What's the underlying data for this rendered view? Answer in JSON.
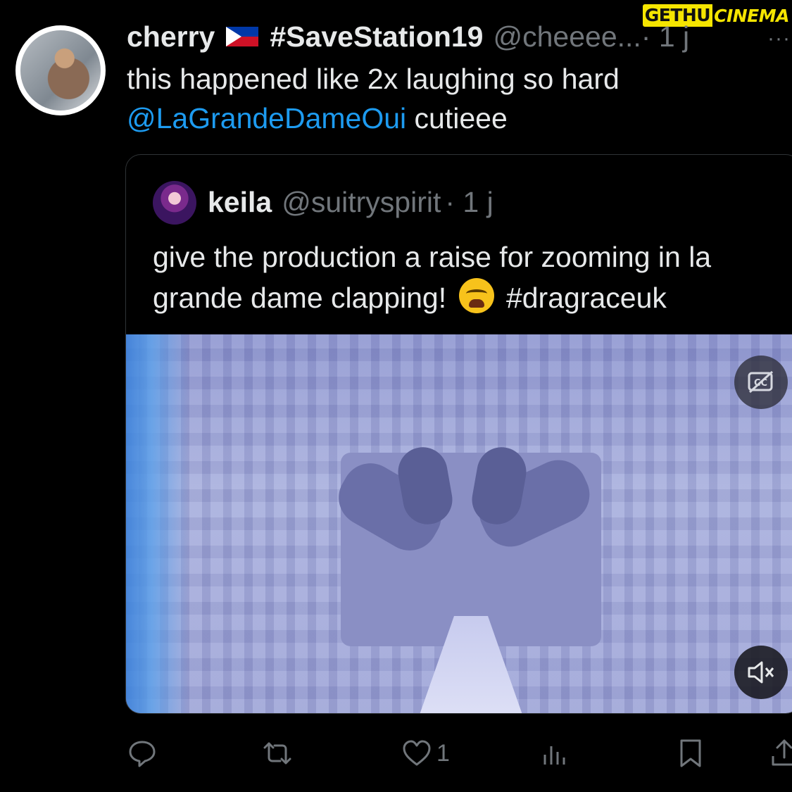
{
  "watermark": {
    "left": "GETHU",
    "right": "CINEMA"
  },
  "tweet": {
    "name": "cherry",
    "hashtag": "#SaveStation19",
    "handle": "@cheeee...",
    "time": "· 1 j",
    "more": "···",
    "text_part1": "this happened like 2x laughing so hard",
    "mention": "@LaGrandeDameOui",
    "text_part2": " cutieee"
  },
  "quote": {
    "name": "keila",
    "handle": "@suitryspirit",
    "time": "· 1 j",
    "text_part1": "give the production a raise for zooming in la grande dame clapping!",
    "text_part2": "#dragraceuk"
  },
  "actions": {
    "reply_count": "",
    "retweet_count": "",
    "like_count": "1",
    "views_count": ""
  },
  "icons": {
    "reply": "reply-icon",
    "retweet": "retweet-icon",
    "like": "heart-icon",
    "views": "views-icon",
    "bookmark": "bookmark-icon",
    "share": "share-icon",
    "cc": "closed-captions-icon",
    "mute": "muted-speaker-icon"
  },
  "colors": {
    "background": "#000000",
    "text": "#e7e9ea",
    "secondary": "#71767b",
    "link": "#1d9bf0"
  }
}
